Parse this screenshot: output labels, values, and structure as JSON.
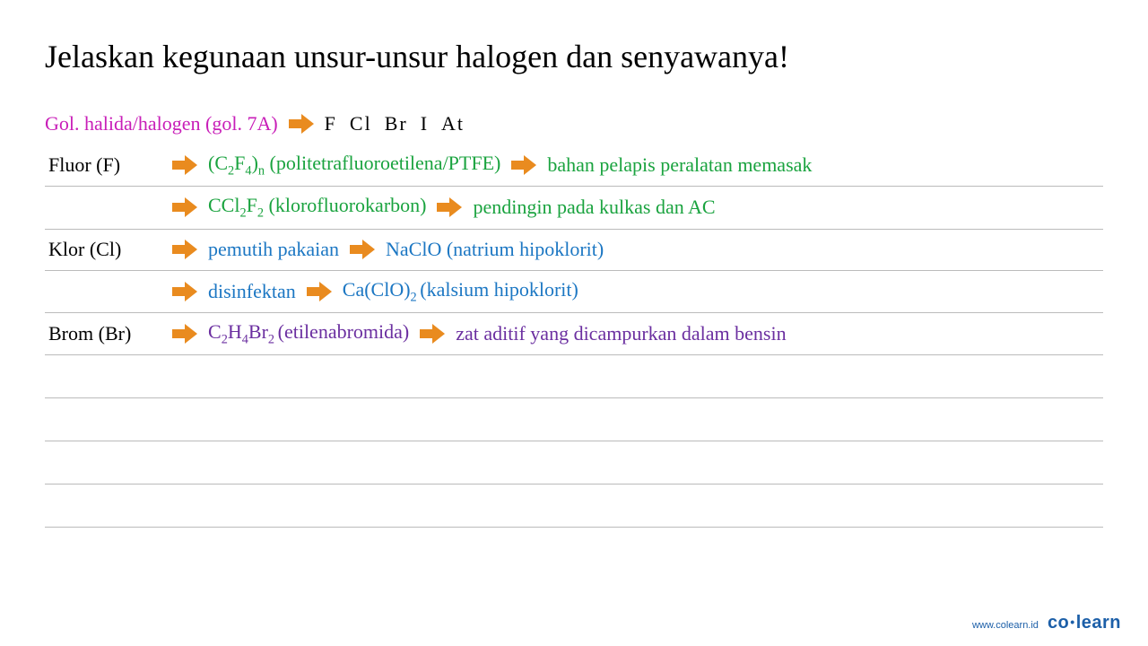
{
  "title": "Jelaskan kegunaan unsur-unsur halogen dan senyawanya!",
  "header": {
    "group_label": "Gol. halida/halogen (gol. 7A)",
    "elements": [
      "F",
      "Cl",
      "Br",
      "I",
      "At"
    ]
  },
  "rows": {
    "fluor": {
      "label": "Fluor (F)",
      "compound1_pre": "(C",
      "compound1_sub1": "2",
      "compound1_mid1": "F",
      "compound1_sub2": "4",
      "compound1_mid2": ")",
      "compound1_sub3": "n",
      "compound1_name": " (politetrafluoroetilena/PTFE)",
      "use1": "bahan pelapis peralatan memasak",
      "compound2_pre": "CCl",
      "compound2_sub1": "2",
      "compound2_mid": "F",
      "compound2_sub2": "2",
      "compound2_name": " (klorofluorokarbon)",
      "use2": "pendingin pada kulkas dan AC"
    },
    "klor": {
      "label": "Klor (Cl)",
      "use1": "pemutih pakaian",
      "compound1": "NaClO (natrium hipoklorit)",
      "use2": "disinfektan",
      "compound2_pre": "Ca(ClO)",
      "compound2_sub": "2 ",
      "compound2_name": "(kalsium hipoklorit)"
    },
    "brom": {
      "label": "Brom (Br)",
      "compound_pre": "C",
      "compound_s1": "2",
      "compound_m1": "H",
      "compound_s2": "4",
      "compound_m2": "Br",
      "compound_s3": "2 ",
      "compound_name": "(etilenabromida)",
      "use": "zat aditif yang dicampurkan dalam bensin"
    }
  },
  "footer": {
    "url": "www.colearn.id",
    "brand_a": "co",
    "brand_b": "learn"
  }
}
